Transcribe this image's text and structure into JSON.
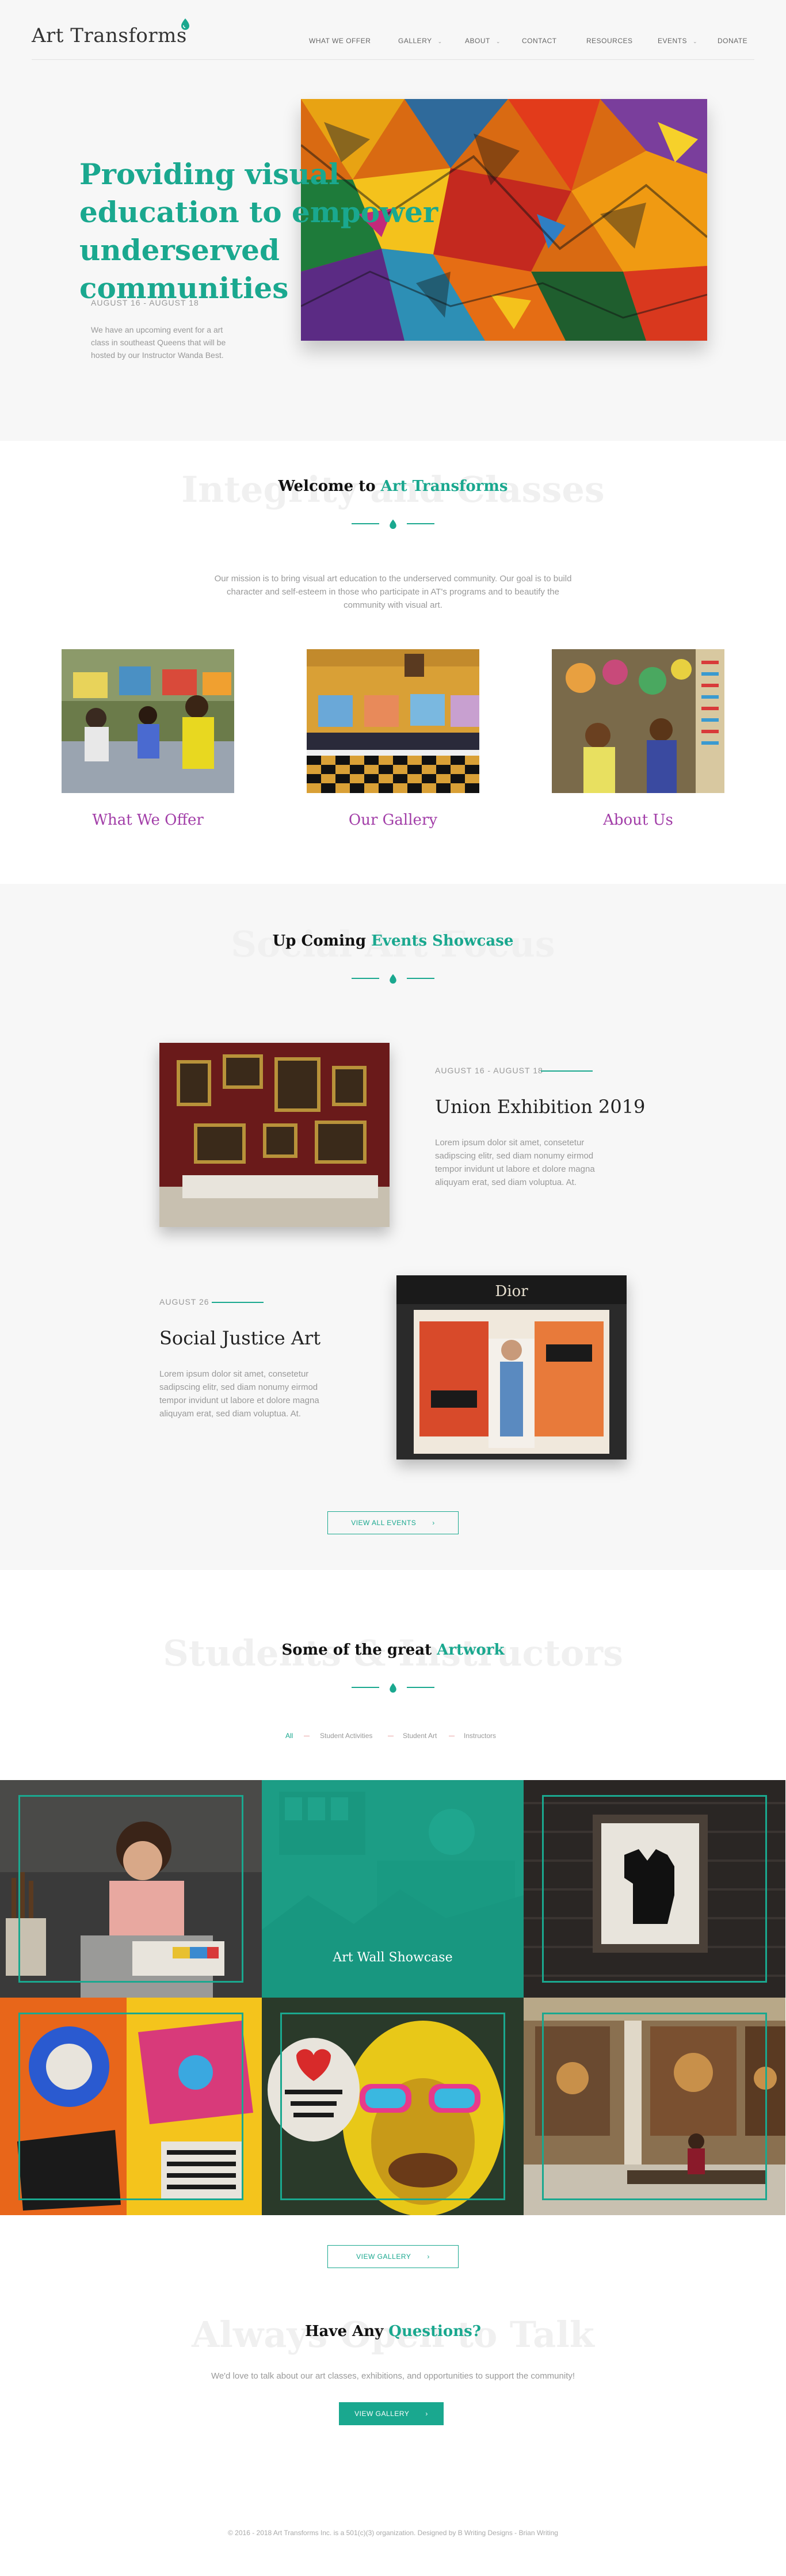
{
  "header": {
    "logo_text": "Art Transforms",
    "nav": [
      {
        "label": "WHAT WE OFFER",
        "dropdown": false
      },
      {
        "label": "GALLERY",
        "dropdown": true
      },
      {
        "label": "ABOUT",
        "dropdown": true
      },
      {
        "label": "CONTACT",
        "dropdown": false
      },
      {
        "label": "RESOURCES",
        "dropdown": false
      },
      {
        "label": "EVENTS",
        "dropdown": true
      },
      {
        "label": "DONATE",
        "dropdown": false
      }
    ]
  },
  "hero": {
    "title": "Providing visual education to empower underserved communities",
    "date": "AUGUST 16 - AUGUST 18",
    "description": "We have an upcoming event for a art class in southeast Queens that will be hosted by our Instructor Wanda Best."
  },
  "welcome": {
    "bg_text": "Integrity and Classes",
    "title_prefix": "Welcome to ",
    "title_highlight": "Art Transforms",
    "text": "Our mission is to bring visual art education to the underserved community. Our goal is to build character and self-esteem in those who participate in AT's programs and to beautify the community with visual art.",
    "cards": [
      {
        "title": "What We Offer"
      },
      {
        "title": "Our Gallery"
      },
      {
        "title": "About Us"
      }
    ]
  },
  "events": {
    "bg_text": "Social Art Focus",
    "title_prefix": "Up Coming ",
    "title_highlight": "Events Showcase",
    "items": [
      {
        "date": "AUGUST 16 - AUGUST 18",
        "title": "Union Exhibition 2019",
        "description": "Lorem ipsum dolor sit amet, consetetur sadipscing elitr, sed diam nonumy eirmod tempor invidunt ut labore et dolore magna aliquyam erat, sed diam voluptua. At."
      },
      {
        "date": "AUGUST 26",
        "title": "Social Justice Art",
        "description": "Lorem ipsum dolor sit amet, consetetur sadipscing elitr, sed diam nonumy eirmod tempor invidunt ut labore et dolore magna aliquyam erat, sed diam voluptua. At."
      }
    ],
    "button_label": "VIEW ALL EVENTS",
    "sign_text": "Dior"
  },
  "artwork": {
    "bg_text": "Students & Instructors",
    "title_prefix": "Some of the great ",
    "title_highlight": "Artwork",
    "filters": [
      {
        "label": "All",
        "active": true
      },
      {
        "label": "Student Activities",
        "active": false
      },
      {
        "label": "Student Art",
        "active": false
      },
      {
        "label": "Instructors",
        "active": false
      }
    ],
    "featured_caption": "Art Wall Showcase",
    "button_label": "VIEW GALLERY"
  },
  "questions": {
    "bg_text": "Always Open to Talk",
    "title_prefix": "Have Any ",
    "title_highlight": "Questions?",
    "text": "We'd love to talk about our art classes, exhibitions, and opportunities to support the community!",
    "button_label": "VIEW GALLERY"
  },
  "footer": {
    "text": "© 2016 - 2018 Art Transforms Inc. is a 501(c)(3) organization. Designed by B Writing Designs - Brian Writing"
  },
  "colors": {
    "accent": "#1aa88f",
    "card_title": "#a23ea8",
    "section_bg": "#f7f7f7"
  },
  "icons": {
    "arrow": "chevron-right-icon",
    "dropdown": "chevron-down-icon",
    "logo_mark": "paint-drop-icon",
    "divider_mark": "paint-drop-icon"
  }
}
